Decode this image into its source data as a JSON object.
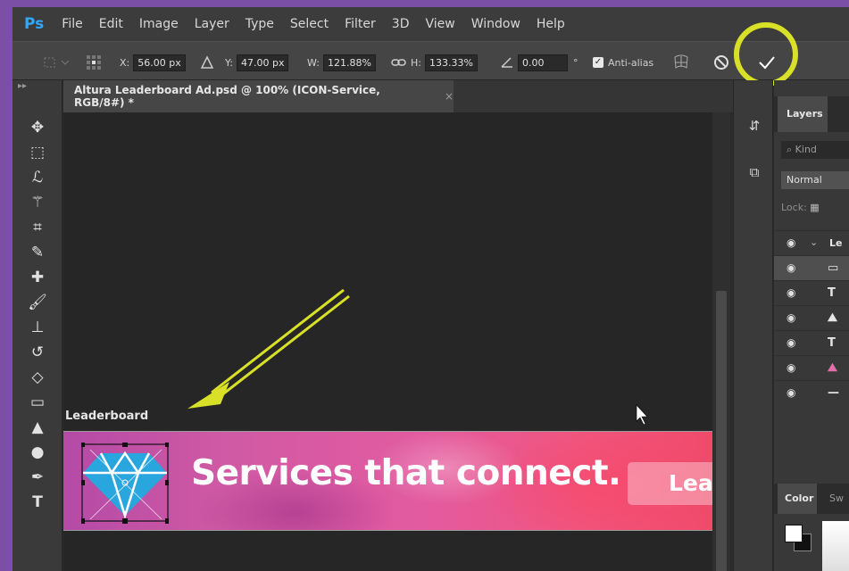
{
  "app": {
    "logo": "Ps"
  },
  "menu": [
    "File",
    "Edit",
    "Image",
    "Layer",
    "Type",
    "Select",
    "Filter",
    "3D",
    "View",
    "Window",
    "Help"
  ],
  "options": {
    "x_label": "X:",
    "x_value": "56.00 px",
    "y_label": "Y:",
    "y_value": "47.00 px",
    "w_label": "W:",
    "w_value": "121.88%",
    "h_label": "H:",
    "h_value": "133.33%",
    "angle_value": "0.00",
    "angle_unit": "°",
    "antialias_label": "Anti-alias",
    "antialias_checked": true
  },
  "document": {
    "tab_title": "Altura Leaderboard Ad.psd @ 100% (ICON-Service, RGB/8#) *",
    "close": "×",
    "artboard_label": "Leaderboard",
    "banner_headline": "Services that connect.",
    "banner_cta": "Lear"
  },
  "panels": {
    "layers_tab": "Layers",
    "kind_placeholder": "Kind",
    "blend_mode": "Normal",
    "lock_label": "Lock:",
    "group_name": "Le",
    "layers": [
      {
        "type": "group",
        "thumb": ""
      },
      {
        "type": "shape",
        "thumb": ""
      },
      {
        "type": "text",
        "thumb": "T"
      },
      {
        "type": "image",
        "thumb": ""
      },
      {
        "type": "text",
        "thumb": "T"
      },
      {
        "type": "image",
        "thumb": ""
      },
      {
        "type": "line",
        "thumb": ""
      }
    ],
    "color_tab": "Color",
    "swatches_tab": "Sw"
  },
  "colors": {
    "annotation": "#d8e027",
    "ps_blue": "#31a8ff",
    "diamond_blue": "#2aa6df"
  }
}
